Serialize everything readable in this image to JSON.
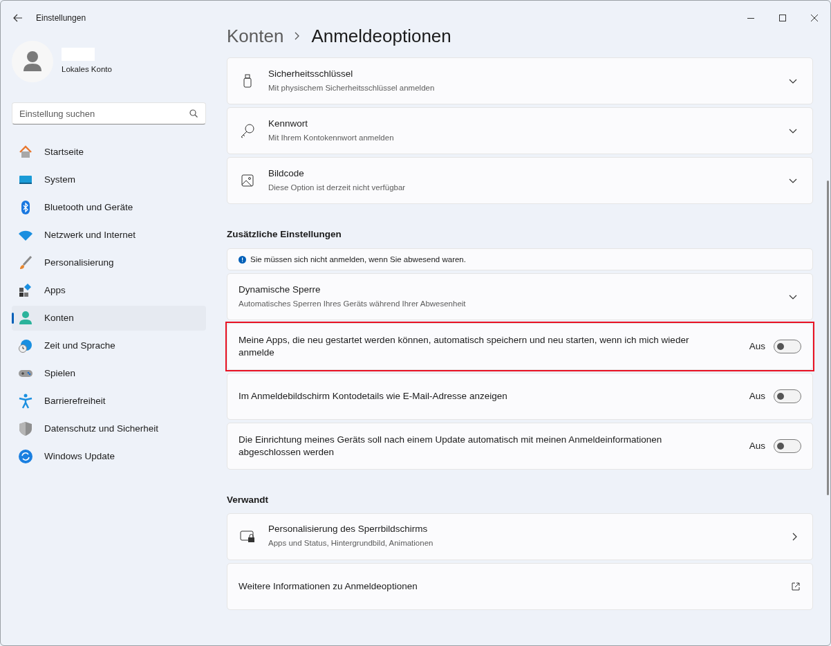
{
  "window": {
    "title": "Einstellungen"
  },
  "account": {
    "type": "Lokales Konto"
  },
  "search": {
    "placeholder": "Einstellung suchen"
  },
  "sidebar": {
    "items": [
      {
        "label": "Startseite",
        "selected": false
      },
      {
        "label": "System",
        "selected": false
      },
      {
        "label": "Bluetooth und Geräte",
        "selected": false
      },
      {
        "label": "Netzwerk und Internet",
        "selected": false
      },
      {
        "label": "Personalisierung",
        "selected": false
      },
      {
        "label": "Apps",
        "selected": false
      },
      {
        "label": "Konten",
        "selected": true
      },
      {
        "label": "Zeit und Sprache",
        "selected": false
      },
      {
        "label": "Spielen",
        "selected": false
      },
      {
        "label": "Barrierefreiheit",
        "selected": false
      },
      {
        "label": "Datenschutz und Sicherheit",
        "selected": false
      },
      {
        "label": "Windows Update",
        "selected": false
      }
    ]
  },
  "breadcrumb": [
    "Konten",
    "Anmeldeoptionen"
  ],
  "signin_methods": [
    {
      "title": "Sicherheitsschlüssel",
      "subtitle": "Mit physischem Sicherheitsschlüssel anmelden"
    },
    {
      "title": "Kennwort",
      "subtitle": "Mit Ihrem Kontokennwort anmelden"
    },
    {
      "title": "Bildcode",
      "subtitle": "Diese Option ist derzeit nicht verfügbar"
    }
  ],
  "additional": {
    "heading": "Zusätzliche Einstellungen",
    "info": "Sie müssen sich nicht anmelden, wenn Sie abwesend waren.",
    "rows": [
      {
        "kind": "expander",
        "title": "Dynamische Sperre",
        "subtitle": "Automatisches Sperren Ihres Geräts während Ihrer Abwesenheit"
      },
      {
        "kind": "toggle",
        "title": "Meine Apps, die neu gestartet werden können, automatisch speichern und neu starten, wenn ich mich wieder anmelde",
        "state_label": "Aus",
        "on": false,
        "highlighted": true
      },
      {
        "kind": "toggle",
        "title": "Im Anmeldebildschirm Kontodetails wie E-Mail-Adresse anzeigen",
        "state_label": "Aus",
        "on": false,
        "highlighted": false
      },
      {
        "kind": "toggle",
        "title": "Die Einrichtung meines Geräts soll nach einem Update automatisch mit meinen Anmeldeinformationen abgeschlossen werden",
        "state_label": "Aus",
        "on": false,
        "highlighted": false
      }
    ]
  },
  "related": {
    "heading": "Verwandt",
    "rows": [
      {
        "kind": "link",
        "title": "Personalisierung des Sperrbildschirms",
        "subtitle": "Apps und Status, Hintergrundbild, Animationen"
      },
      {
        "kind": "external",
        "title": "Weitere Informationen zu Anmeldeoptionen"
      }
    ]
  }
}
